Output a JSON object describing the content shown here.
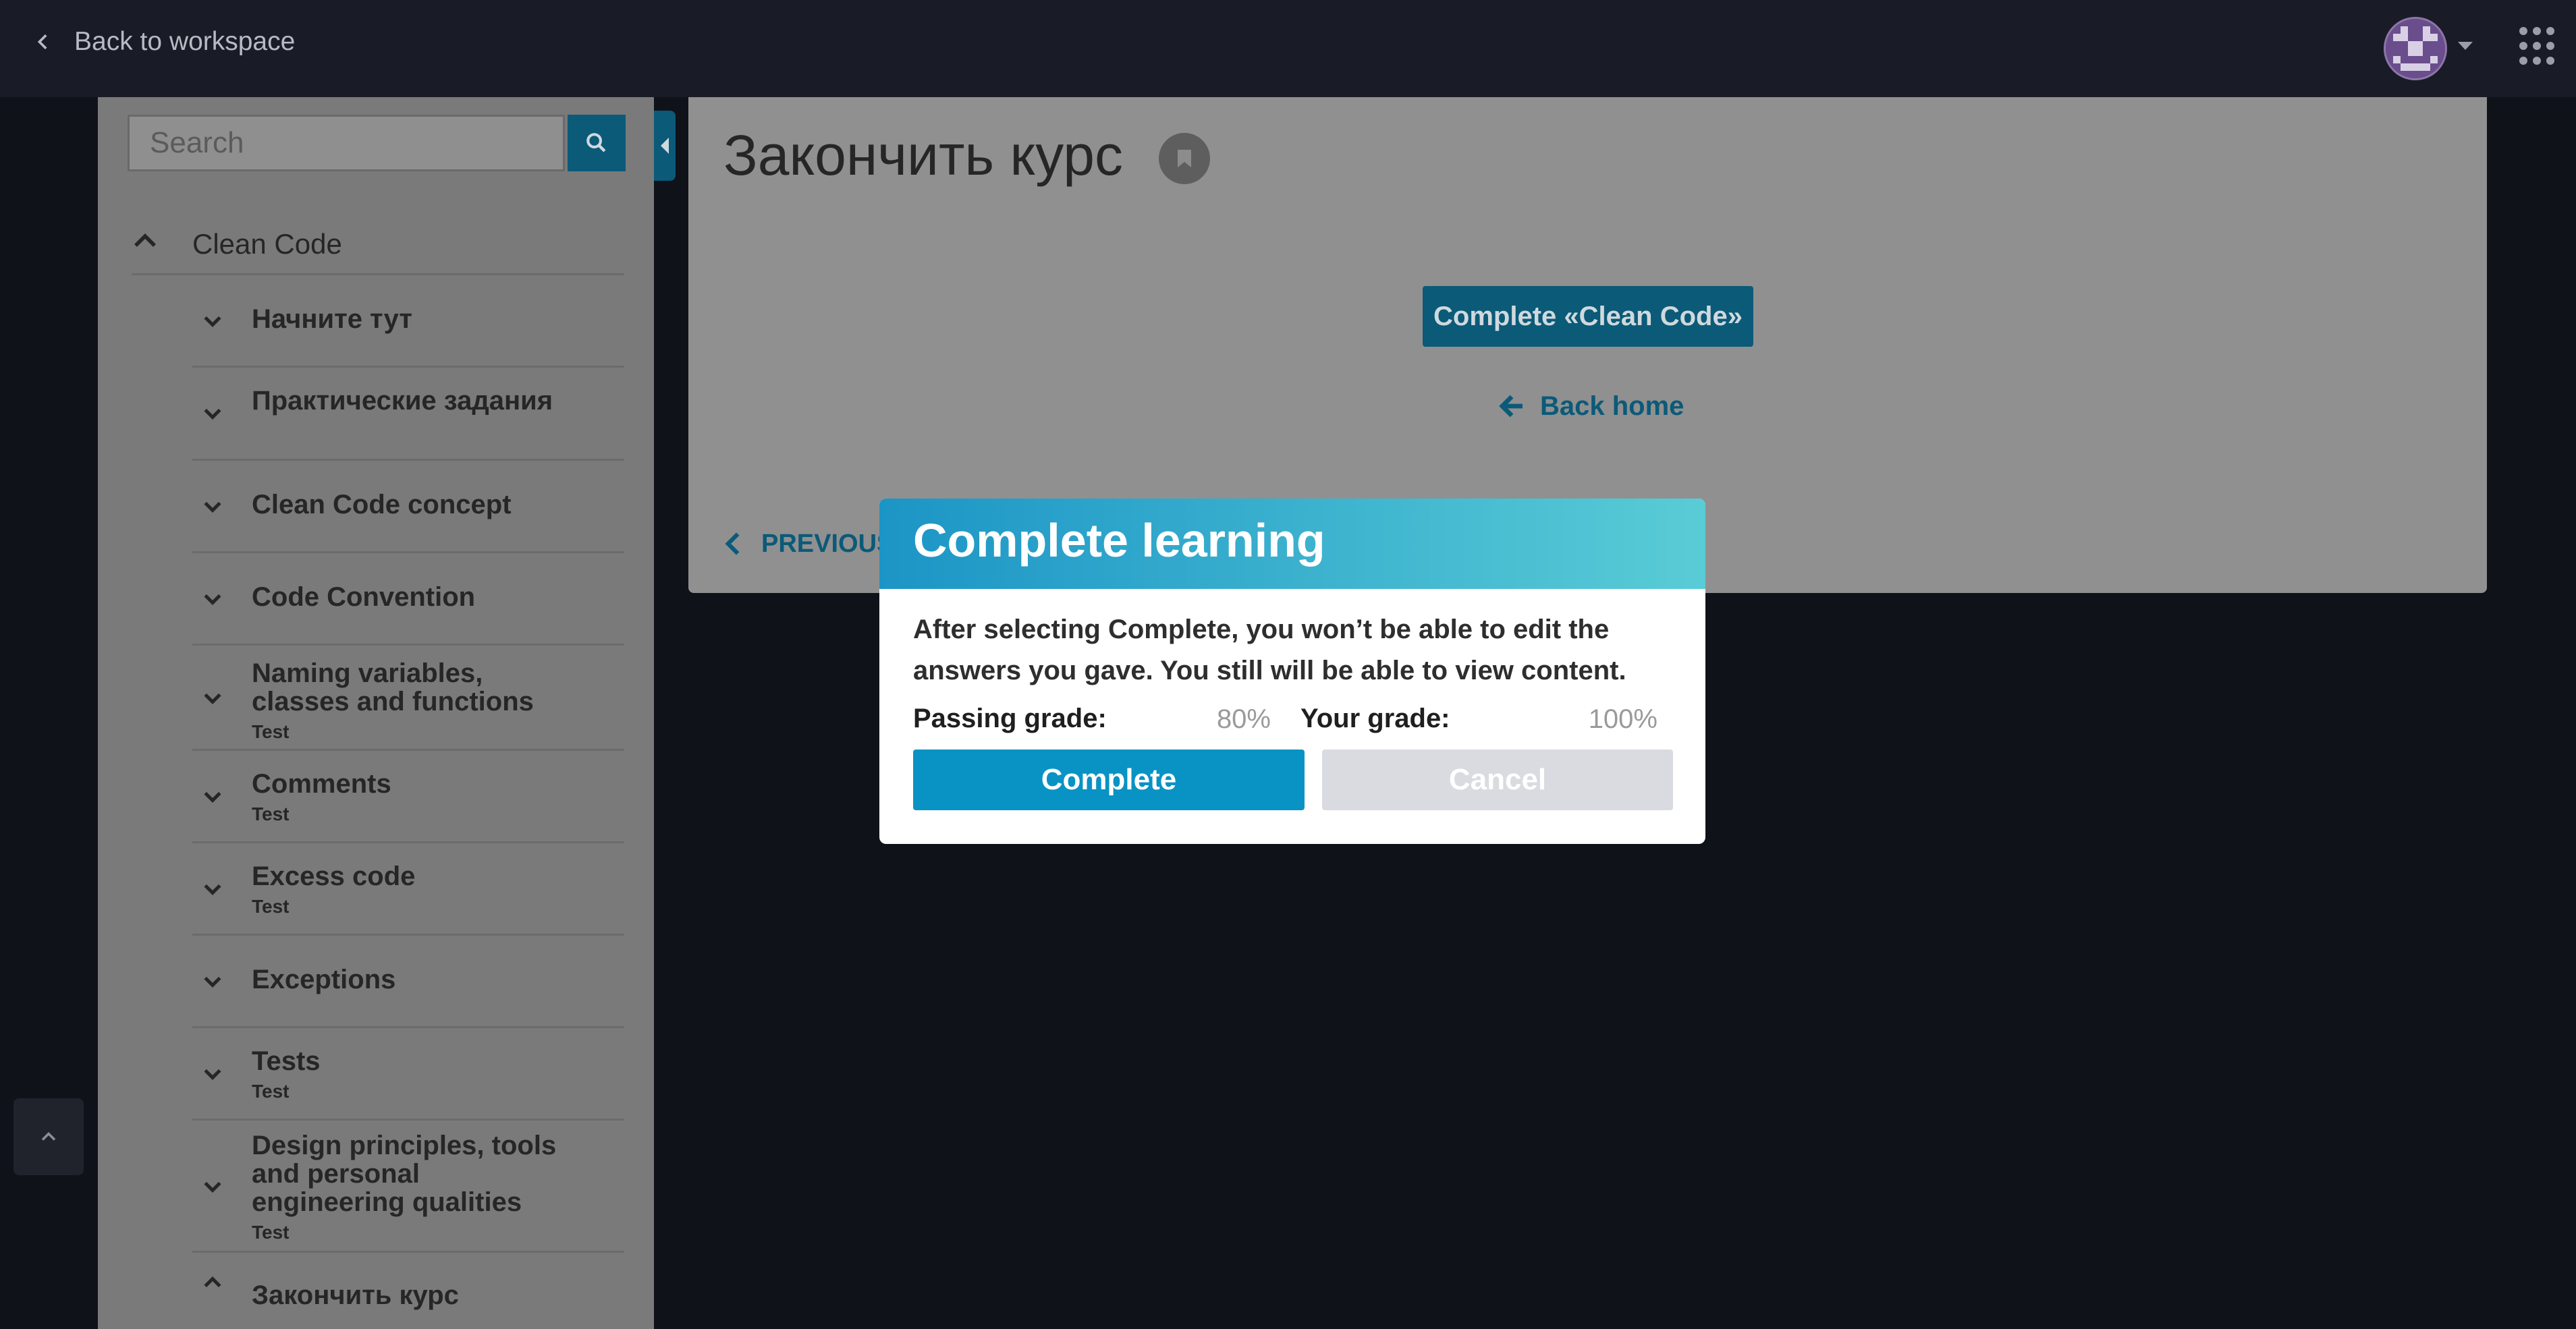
{
  "topbar": {
    "back_label": "Back to workspace"
  },
  "sidebar": {
    "search_placeholder": "Search",
    "course_title": "Clean Code",
    "items": [
      {
        "title": "Начните тут",
        "subtitle": ""
      },
      {
        "title": "Практические задания",
        "subtitle": ""
      },
      {
        "title": "Clean Code concept",
        "subtitle": ""
      },
      {
        "title": "Code Convention",
        "subtitle": ""
      },
      {
        "title": "Naming variables, classes and functions",
        "subtitle": "Test"
      },
      {
        "title": "Comments",
        "subtitle": "Test"
      },
      {
        "title": "Excess code",
        "subtitle": "Test"
      },
      {
        "title": "Exceptions",
        "subtitle": ""
      },
      {
        "title": "Tests",
        "subtitle": "Test"
      },
      {
        "title": "Design principles, tools and personal engineering qualities",
        "subtitle": "Test"
      },
      {
        "title": "Закончить курс",
        "subtitle": ""
      }
    ]
  },
  "content": {
    "page_title": "Закончить курс",
    "complete_course_button": "Complete «Clean Code»",
    "back_home": "Back home",
    "previous": "PREVIOUS"
  },
  "modal": {
    "title": "Complete learning",
    "body": "After selecting Complete, you won’t be able to edit the answers you gave. You still will be able to view content.",
    "passing_grade_label": "Passing grade:",
    "passing_grade_value": "80%",
    "your_grade_label": "Your grade:",
    "your_grade_value": "100%",
    "complete_button": "Complete",
    "cancel_button": "Cancel"
  },
  "colors": {
    "accent": "#0993c4",
    "check_green": "#2f5d12",
    "overlay_sidebar": "#7a7a7a"
  }
}
